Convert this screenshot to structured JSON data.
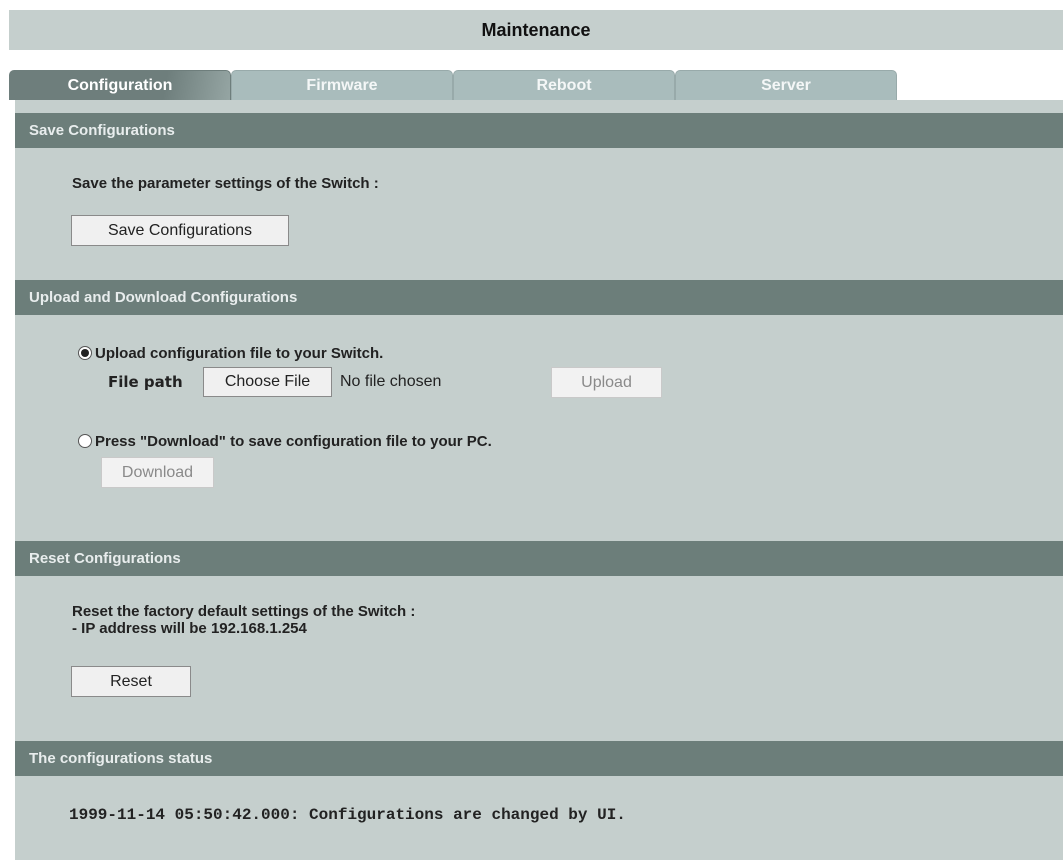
{
  "page": {
    "title": "Maintenance"
  },
  "tabs": [
    {
      "label": "Configuration",
      "active": true
    },
    {
      "label": "Firmware",
      "active": false
    },
    {
      "label": "Reboot",
      "active": false
    },
    {
      "label": "Server",
      "active": false
    }
  ],
  "save_section": {
    "header": "Save Configurations",
    "description": "Save the parameter settings of the Switch :",
    "button_label": "Save Configurations"
  },
  "upload_section": {
    "header": "Upload and Download Configurations",
    "upload_option_label": "Upload configuration file to your Switch.",
    "upload_selected": true,
    "file_path_label": "File path",
    "choose_file_label": "Choose File",
    "no_file_text": "No file chosen",
    "upload_button_label": "Upload",
    "download_option_label": "Press \"Download\" to save configuration file to your PC.",
    "download_selected": false,
    "download_button_label": "Download"
  },
  "reset_section": {
    "header": "Reset Configurations",
    "description_line1": "Reset the factory default settings of the Switch :",
    "description_line2": "- IP address will be 192.168.1.254",
    "button_label": "Reset"
  },
  "status_section": {
    "header": "The configurations status",
    "message": "1999-11-14 05:50:42.000: Configurations are changed by UI."
  },
  "colors": {
    "panel_bg": "#c5cfcd",
    "section_header_bg": "#6c7e7a",
    "tab_inactive_bg": "#a9bcbc",
    "tab_active_bg": "#6e7e7c"
  }
}
